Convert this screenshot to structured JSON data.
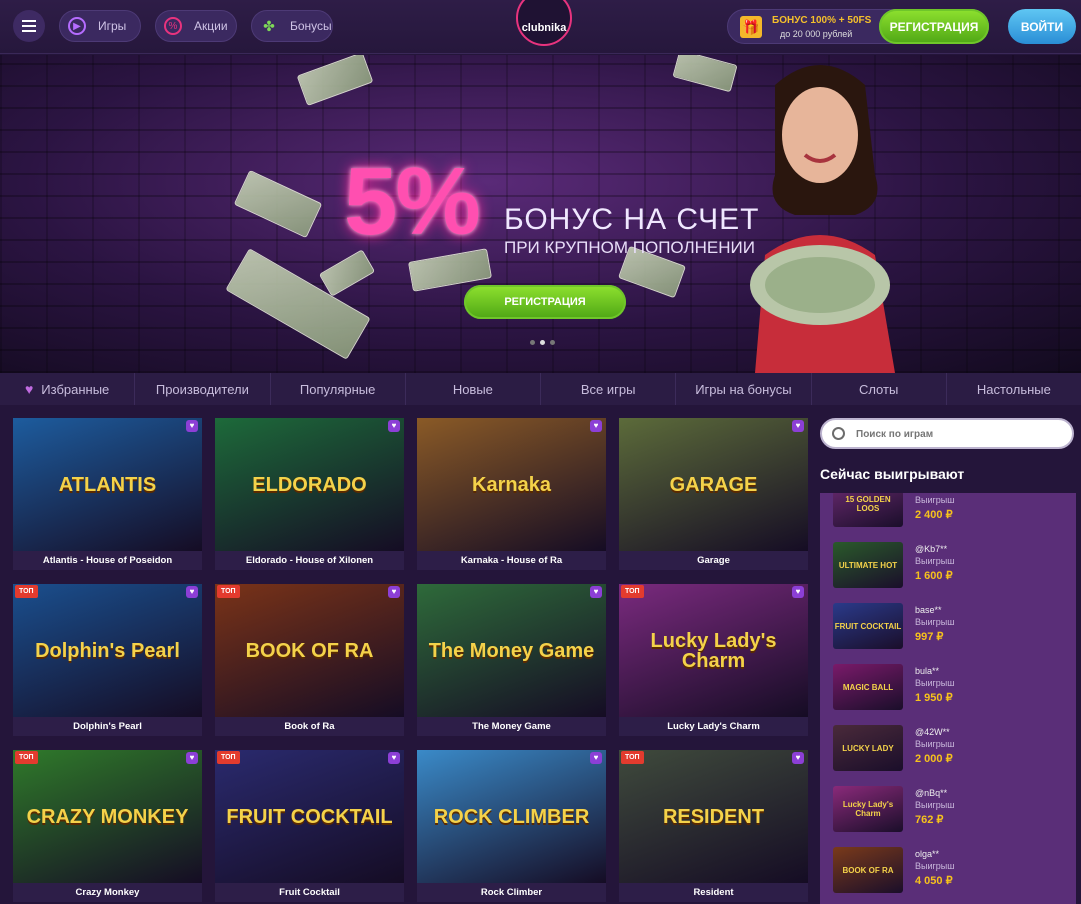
{
  "header": {
    "menu_icon": "hamburger-icon",
    "nav": [
      {
        "label": "Игры",
        "icon": "play-icon"
      },
      {
        "label": "Акции",
        "icon": "percent-icon"
      },
      {
        "label": "Бонусы",
        "icon": "clover-icon"
      }
    ],
    "logo_text": "clubnika",
    "bonus_line1": "БОНУС 100% + 50FS",
    "bonus_line2": "до 20 000 рублей",
    "register_label": "РЕГИСТРАЦИЯ",
    "login_label": "ВОЙТИ"
  },
  "banner": {
    "percent": "5%",
    "headline": "БОНУС НА СЧЕТ",
    "subheadline": "ПРИ КРУПНОМ ПОПОЛНЕНИИ",
    "cta_label": "РЕГИСТРАЦИЯ",
    "slides": 3,
    "active_slide": 2
  },
  "categories": [
    "Избранные",
    "Производители",
    "Популярные",
    "Новые",
    "Все игры",
    "Игры на бонусы",
    "Слоты",
    "Настольные"
  ],
  "games": [
    {
      "title": "Atlantis - House of Poseidon",
      "art": "ATLANTIS",
      "top": false,
      "bg": "#1d5c9e"
    },
    {
      "title": "Eldorado - House of Xilonen",
      "art": "ELDORADO",
      "top": false,
      "bg": "#1d6a3a"
    },
    {
      "title": "Karnaka - House of Ra",
      "art": "Karnaka",
      "top": false,
      "bg": "#8a5a26"
    },
    {
      "title": "Garage",
      "art": "GARAGE",
      "top": false,
      "bg": "#5c6b3a"
    },
    {
      "title": "Dolphin's Pearl",
      "art": "Dolphin's Pearl",
      "top": true,
      "bg": "#1a4f8e"
    },
    {
      "title": "Book of Ra",
      "art": "BOOK OF RA",
      "top": true,
      "bg": "#7a3318"
    },
    {
      "title": "The Money Game",
      "art": "The Money Game",
      "top": false,
      "bg": "#2e6a3a"
    },
    {
      "title": "Lucky Lady's Charm",
      "art": "Lucky Lady's Charm",
      "top": true,
      "bg": "#7a2a7e"
    },
    {
      "title": "Crazy Monkey",
      "art": "CRAZY MONKEY",
      "top": true,
      "bg": "#2f7a2a"
    },
    {
      "title": "Fruit Cocktail",
      "art": "FRUIT COCKTAIL",
      "top": true,
      "bg": "#2a2a6e"
    },
    {
      "title": "Rock Climber",
      "art": "ROCK CLIMBER",
      "top": false,
      "bg": "#3a8ac8"
    },
    {
      "title": "Resident",
      "art": "RESIDENT",
      "top": true,
      "bg": "#3f4a3c"
    }
  ],
  "top_badge": "ТОП",
  "search": {
    "placeholder": "Поиск по играм"
  },
  "winners_title": "Сейчас выигрывают",
  "win_label": "Выигрыш",
  "winners": [
    {
      "name": "",
      "amount": "2 400 ₽",
      "game": "15 GOLDEN LOOS",
      "bg": "#6a2a70"
    },
    {
      "name": "@Kb7**",
      "amount": "1 600 ₽",
      "game": "ULTIMATE HOT",
      "bg": "#2a5a2a"
    },
    {
      "name": "base**",
      "amount": "997 ₽",
      "game": "FRUIT COCKTAIL",
      "bg": "#2a3a8a"
    },
    {
      "name": "bula**",
      "amount": "1 950 ₽",
      "game": "MAGIC BALL",
      "bg": "#7a1a6a"
    },
    {
      "name": "@42W**",
      "amount": "2 000 ₽",
      "game": "LUCKY LADY",
      "bg": "#4a2a3a"
    },
    {
      "name": "@nBq**",
      "amount": "762 ₽",
      "game": "Lucky Lady's Charm",
      "bg": "#8a2a7a"
    },
    {
      "name": "olga**",
      "amount": "4 050 ₽",
      "game": "BOOK OF RA",
      "bg": "#7a3a1a"
    }
  ]
}
